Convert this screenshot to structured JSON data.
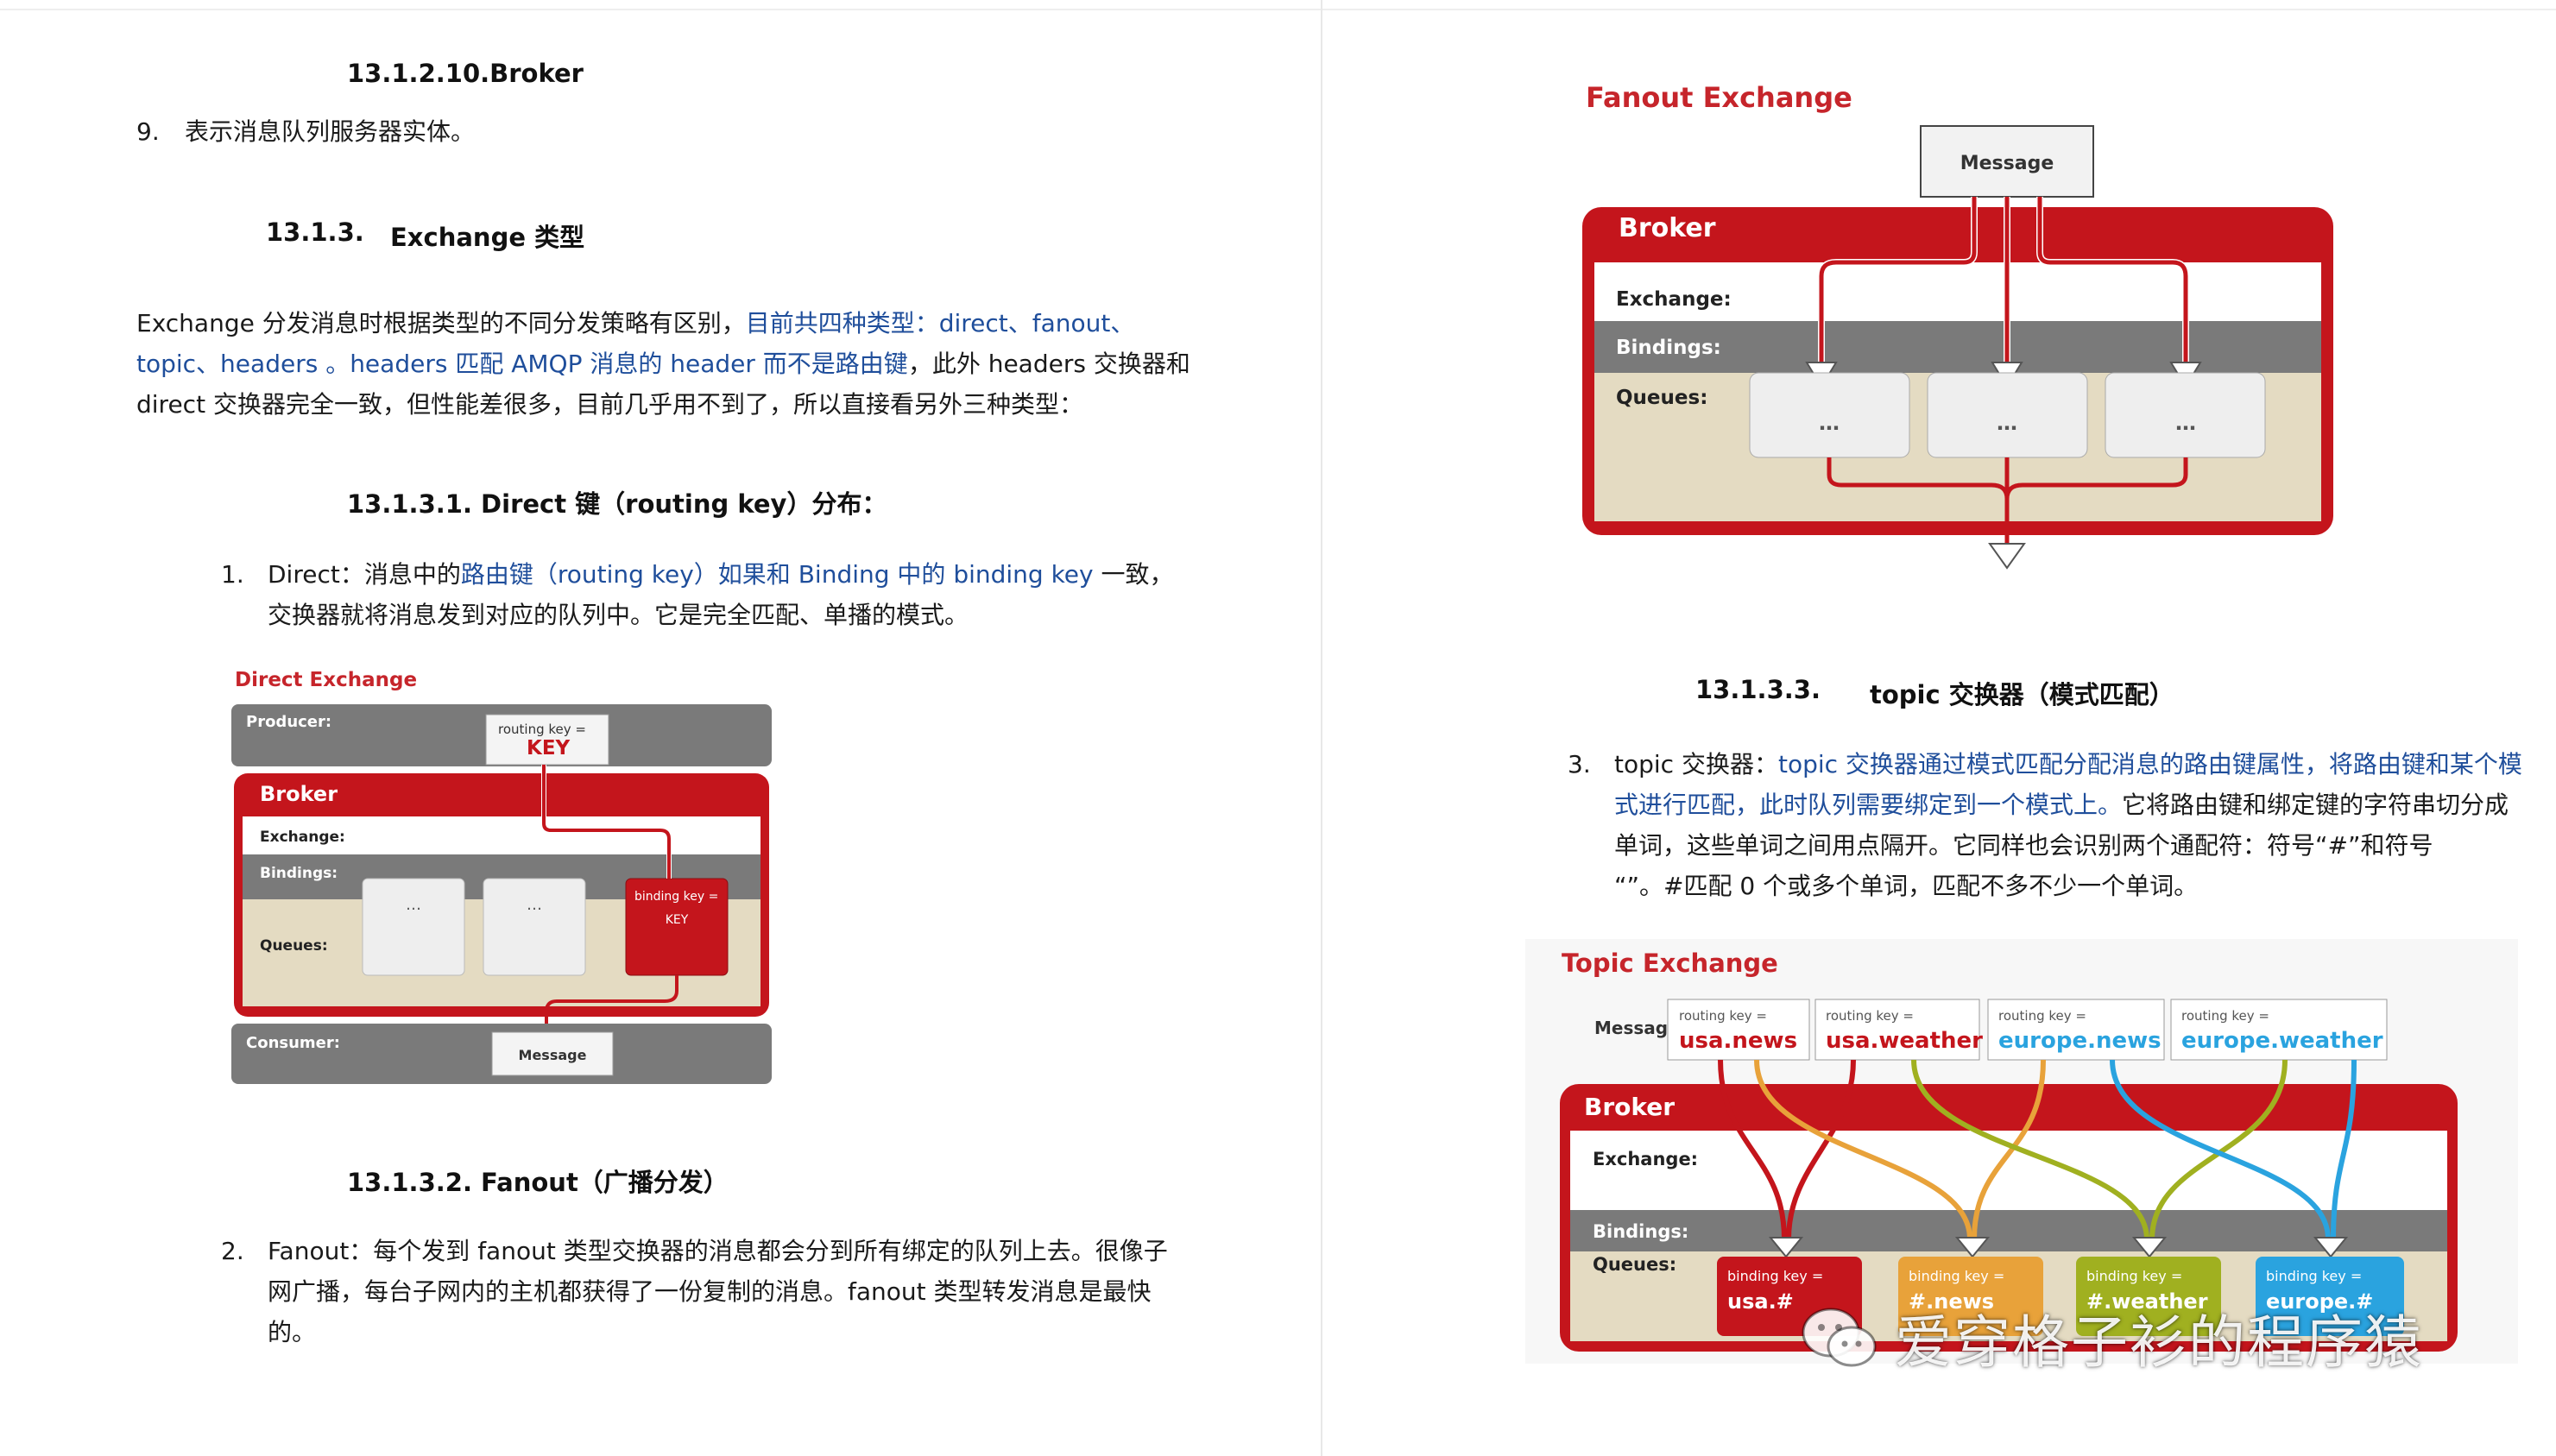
{
  "left": {
    "broker_heading": "13.1.2.10.Broker",
    "item9_num": "9.",
    "item9_text": "表示消息队列服务器实体。",
    "exchange_types_heading_num": "13.1.3.",
    "exchange_types_heading_text": "Exchange 类型",
    "para1_line1_a": "Exchange 分发消息时根据类型的不同分发策略有区别，",
    "para1_line1_b": "目前共四种类型：direct、fanout、",
    "para1_line2_a": "topic、headers 。headers 匹配 AMQP 消息的 header 而不是路由键",
    "para1_line2_b": "，此外 headers 交换器和",
    "para1_line3": "direct 交换器完全一致，但性能差很多，目前几乎用不到了，所以直接看另外三种类型：",
    "direct_heading": "13.1.3.1.  Direct 键（routing key）分布：",
    "item1_num": "1.",
    "item1_line1_a": "Direct：消息中的",
    "item1_line1_b": "路由键（routing key）如果和 Binding 中的 binding key",
    "item1_line1_c": " 一致，",
    "item1_line2": "交换器就将消息发到对应的队列中。它是完全匹配、单播的模式。",
    "fanout_heading": "13.1.3.2.  Fanout（广播分发）",
    "item2_num": "2.",
    "item2_line1": "Fanout：每个发到 fanout 类型交换器的消息都会分到所有绑定的队列上去。很像子",
    "item2_line2": "网广播，每台子网内的主机都获得了一份复制的消息。fanout 类型转发消息是最快",
    "item2_line3": "的。"
  },
  "direct_diagram": {
    "title": "Direct Exchange",
    "producer": "Producer:",
    "routing_key_label": "routing key =",
    "routing_key_value": "KEY",
    "broker": "Broker",
    "exchange": "Exchange:",
    "bindings": "Bindings:",
    "queues": "Queues:",
    "queue_dots": "…",
    "binding_key_label": "binding key =",
    "binding_key_value": "KEY",
    "consumer": "Consumer:",
    "message": "Message"
  },
  "right": {
    "topic_heading_num": "13.1.3.3.",
    "topic_heading_text": "topic 交换器（模式匹配）",
    "item3_num": "3.",
    "item3_line1_a": "topic 交换器：",
    "item3_line1_b": "topic 交换器通过模式匹配分配消息的路由键属性，将路由键和某个模",
    "item3_line2_a": "式进行匹配，此时队列需要绑定到一个模式上。",
    "item3_line2_b": "它将路由键和绑定键的字符串切分成",
    "item3_line3": "单词，这些单词之间用点隔开。它同样也会识别两个通配符：符号“#”和符号",
    "item3_line4": "“”。#匹配 0 个或多个单词，匹配不多不少一个单词。"
  },
  "fanout_diagram": {
    "title": "Fanout Exchange",
    "message": "Message",
    "broker": "Broker",
    "exchange": "Exchange:",
    "bindings": "Bindings:",
    "queues": "Queues:",
    "queue_dots": "…"
  },
  "topic_diagram": {
    "title": "Topic Exchange",
    "messages_label": "Messages:",
    "routing_key_label": "routing key =",
    "routing_keys": [
      "usa.news",
      "usa.weather",
      "europe.news",
      "europe.weather"
    ],
    "broker": "Broker",
    "exchange": "Exchange:",
    "bindings": "Bindings:",
    "queues": "Queues:",
    "binding_key_label": "binding key =",
    "binding_keys": [
      "usa.#",
      "#.news",
      "#.weather",
      "europe.#"
    ],
    "colors": {
      "red": "#c4151c",
      "orange": "#e8a23a",
      "olive": "#a0b020",
      "blue": "#2aa3df"
    }
  },
  "watermark": {
    "icon": "wechat-icon",
    "text": "爱穿格子衫的程序猿"
  },
  "colors": {
    "brand_red": "#c4151c",
    "link_blue": "#1f4e9b",
    "gray_band": "#7a7a7a",
    "beige": "#e4dbc2"
  }
}
